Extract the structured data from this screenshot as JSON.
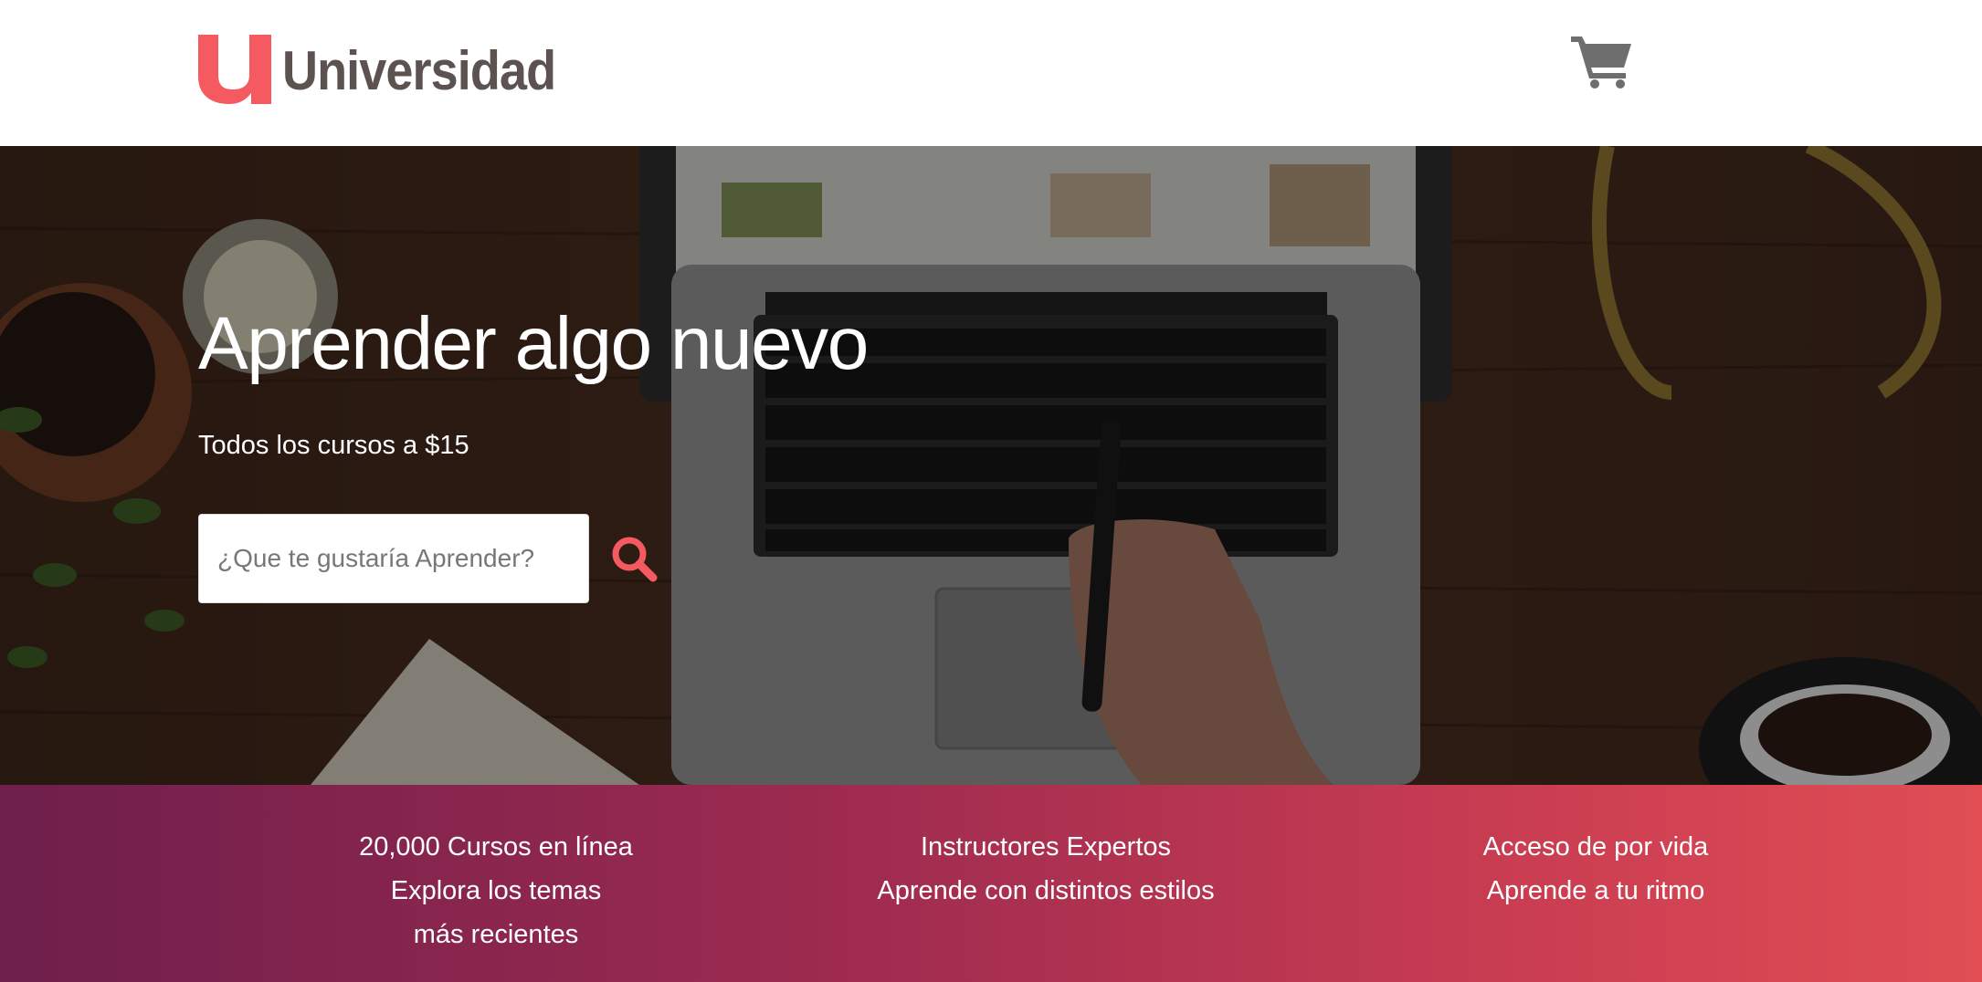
{
  "brand": {
    "name": "Universidad",
    "accent_color": "#f45a5f",
    "text_color": "#5c5250"
  },
  "header": {
    "cart_icon": "shopping-cart-icon"
  },
  "hero": {
    "title": "Aprender algo nuevo",
    "subtitle": "Todos los cursos a $15",
    "search": {
      "placeholder": "¿Que te gustaría Aprender?",
      "value": ""
    },
    "search_icon": "search-icon"
  },
  "features": [
    {
      "title": "20,000 Cursos en línea",
      "subtitle": "Explora los temas más recientes"
    },
    {
      "title": "Instructores Expertos",
      "subtitle": "Aprende con distintos estilos"
    },
    {
      "title": "Acceso de por vida",
      "subtitle": "Aprende a tu ritmo"
    }
  ],
  "colors": {
    "gradient_start": "#6e1f4c",
    "gradient_end": "#e04e54"
  }
}
